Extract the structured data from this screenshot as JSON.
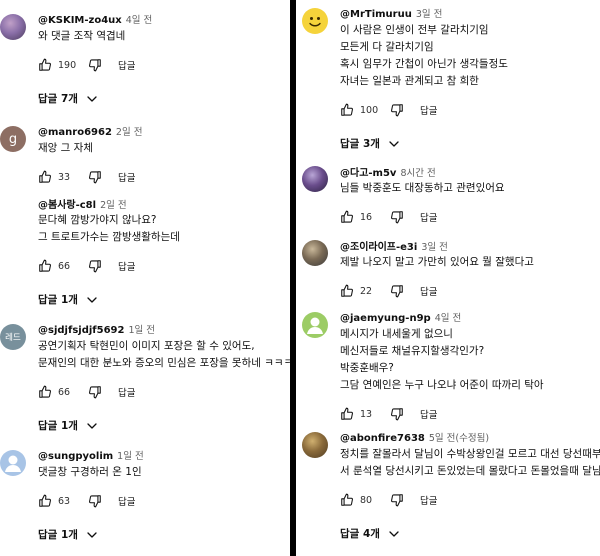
{
  "labels": {
    "reply": "답글"
  },
  "left_comments": [
    {
      "author": "@KSKIM-zo4ux",
      "time": "4일 전",
      "lines": [
        "와 댓글 조작 역겹네"
      ],
      "likes": "190",
      "replies_label": "답글 7개",
      "avatar": {
        "type": "photo",
        "colors": [
          "#4a3b5c",
          "#8a6fa8",
          "#c0a0c8"
        ]
      }
    },
    {
      "author": "@manro6962",
      "time": "2일 전",
      "lines": [
        "재앙 그 자체"
      ],
      "likes": "33",
      "replies_label": "",
      "avatar": {
        "type": "letter",
        "letter": "g",
        "color": "#8d6e63"
      }
    },
    {
      "author": "@봄사랑-c8l",
      "time": "2일 전",
      "lines": [
        "문다혜 깜방가야지 않나요?",
        "그 트로트가수는 깜방생활하는데"
      ],
      "likes": "66",
      "replies_label": "답글 1개",
      "avatar": {
        "type": "blank",
        "color": "#ffffff"
      }
    },
    {
      "author": "@sjdjfsjdjf5692",
      "time": "1일 전",
      "lines": [
        "공연기획자 탁현민이 이미지 포장은 할 수 있어도,",
        "문재인의 대한 분노와 증오의 민심은 포장을 못하네 ㅋㅋㅋㅋ"
      ],
      "likes": "66",
      "replies_label": "답글 1개",
      "avatar": {
        "type": "text",
        "text": "레드",
        "color": "#78909c"
      }
    },
    {
      "author": "@sungpyolim",
      "time": "1일 전",
      "lines": [
        "댓글창 구경하러 온 1인"
      ],
      "likes": "63",
      "replies_label": "답글 1개",
      "avatar": {
        "type": "default",
        "color": "#a8c4e6"
      }
    }
  ],
  "right_comments": [
    {
      "author": "@MrTimuruu",
      "time": "3일 전",
      "lines": [
        "이 사람은 인생이 전부 갈라치기임",
        "모든게 다 갈라치기임",
        "혹시 임무가 간첩이 아닌가 생각들정도",
        "자녀는 일본과 관계되고 참 희한"
      ],
      "likes": "100",
      "replies_label": "답글 3개",
      "avatar": {
        "type": "smiley",
        "color": "#f5d33b"
      }
    },
    {
      "author": "@다고-m5v",
      "time": "8시간 전",
      "lines": [
        "님들 박중훈도 대장동하고 관련있어요"
      ],
      "likes": "16",
      "replies_label": "",
      "avatar": {
        "type": "photo",
        "colors": [
          "#2b2240",
          "#6a4d8c",
          "#b9a6d6"
        ]
      }
    },
    {
      "author": "@조이라이프-e3i",
      "time": "3일 전",
      "lines": [
        "제발 나오지 말고 가만히 있어요 뭘 잘했다고"
      ],
      "likes": "22",
      "replies_label": "",
      "avatar": {
        "type": "photo",
        "colors": [
          "#3a3a3a",
          "#7a6a55",
          "#c9b89a"
        ]
      }
    },
    {
      "author": "@jaemyung-n9p",
      "time": "4일 전",
      "lines": [
        "메시지가 내세울게 없으니",
        "메신저들로 채널유지할생각인가?",
        "박중훈배우?",
        "그담 연예인은 누구 나오냐 어준이 따까리 탁아"
      ],
      "likes": "13",
      "replies_label": "",
      "avatar": {
        "type": "default",
        "color": "#9ccc65"
      }
    },
    {
      "author": "@abonfire7638",
      "time": "5일 전(수정됨)",
      "lines": [
        "정치를 잘몰라서 달님이 수박상왕인걸 모르고 대선 당선때부터",
        "서 룬석열 당선시키고 돈있었는데 몰랐다고 돈몰었을때 달님 정"
      ],
      "likes": "80",
      "replies_label": "답글 4개",
      "avatar": {
        "type": "photo",
        "colors": [
          "#4e3b22",
          "#8a6a3a",
          "#d0b070"
        ]
      }
    }
  ]
}
